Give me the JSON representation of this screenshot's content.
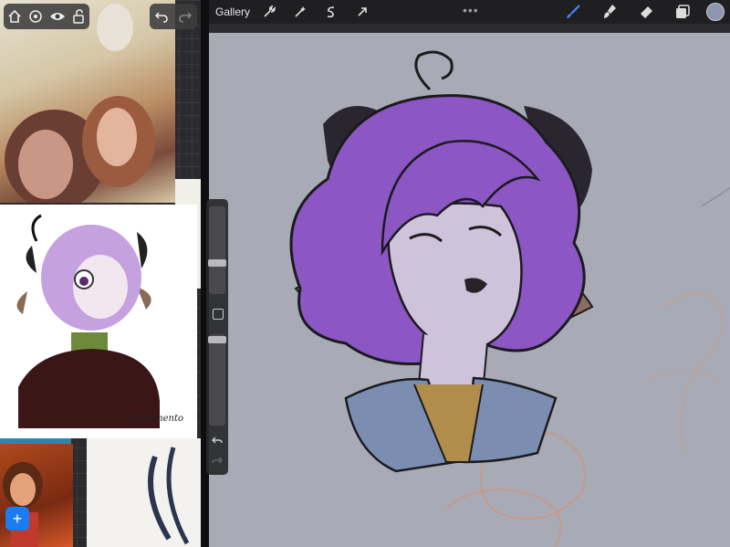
{
  "top_bar": {
    "gallery_label": "Gallery",
    "more_dots": "•••"
  },
  "reference": {
    "signature": "Sacramento"
  },
  "icons": {
    "home": "home-icon",
    "adjust": "adjust-icon",
    "eye": "eye-icon",
    "lock": "unlock-icon",
    "undo": "undo-icon",
    "redo": "redo-icon",
    "add": "plus-icon",
    "wrench": "wrench-icon",
    "magic": "magic-wand-icon",
    "selection": "selection-icon",
    "transform": "transform-arrow-icon",
    "brush": "brush-icon",
    "smudge": "smudge-icon",
    "eraser": "eraser-icon",
    "layers": "layers-icon"
  },
  "colors": {
    "accent": "#1a7cf0",
    "current_color": "#8e97b0",
    "brush_active": "#3a8cff",
    "canvas_bg": "#a8abb5",
    "hair": "#8c57c4"
  },
  "labels": {
    "add_symbol": "+"
  }
}
